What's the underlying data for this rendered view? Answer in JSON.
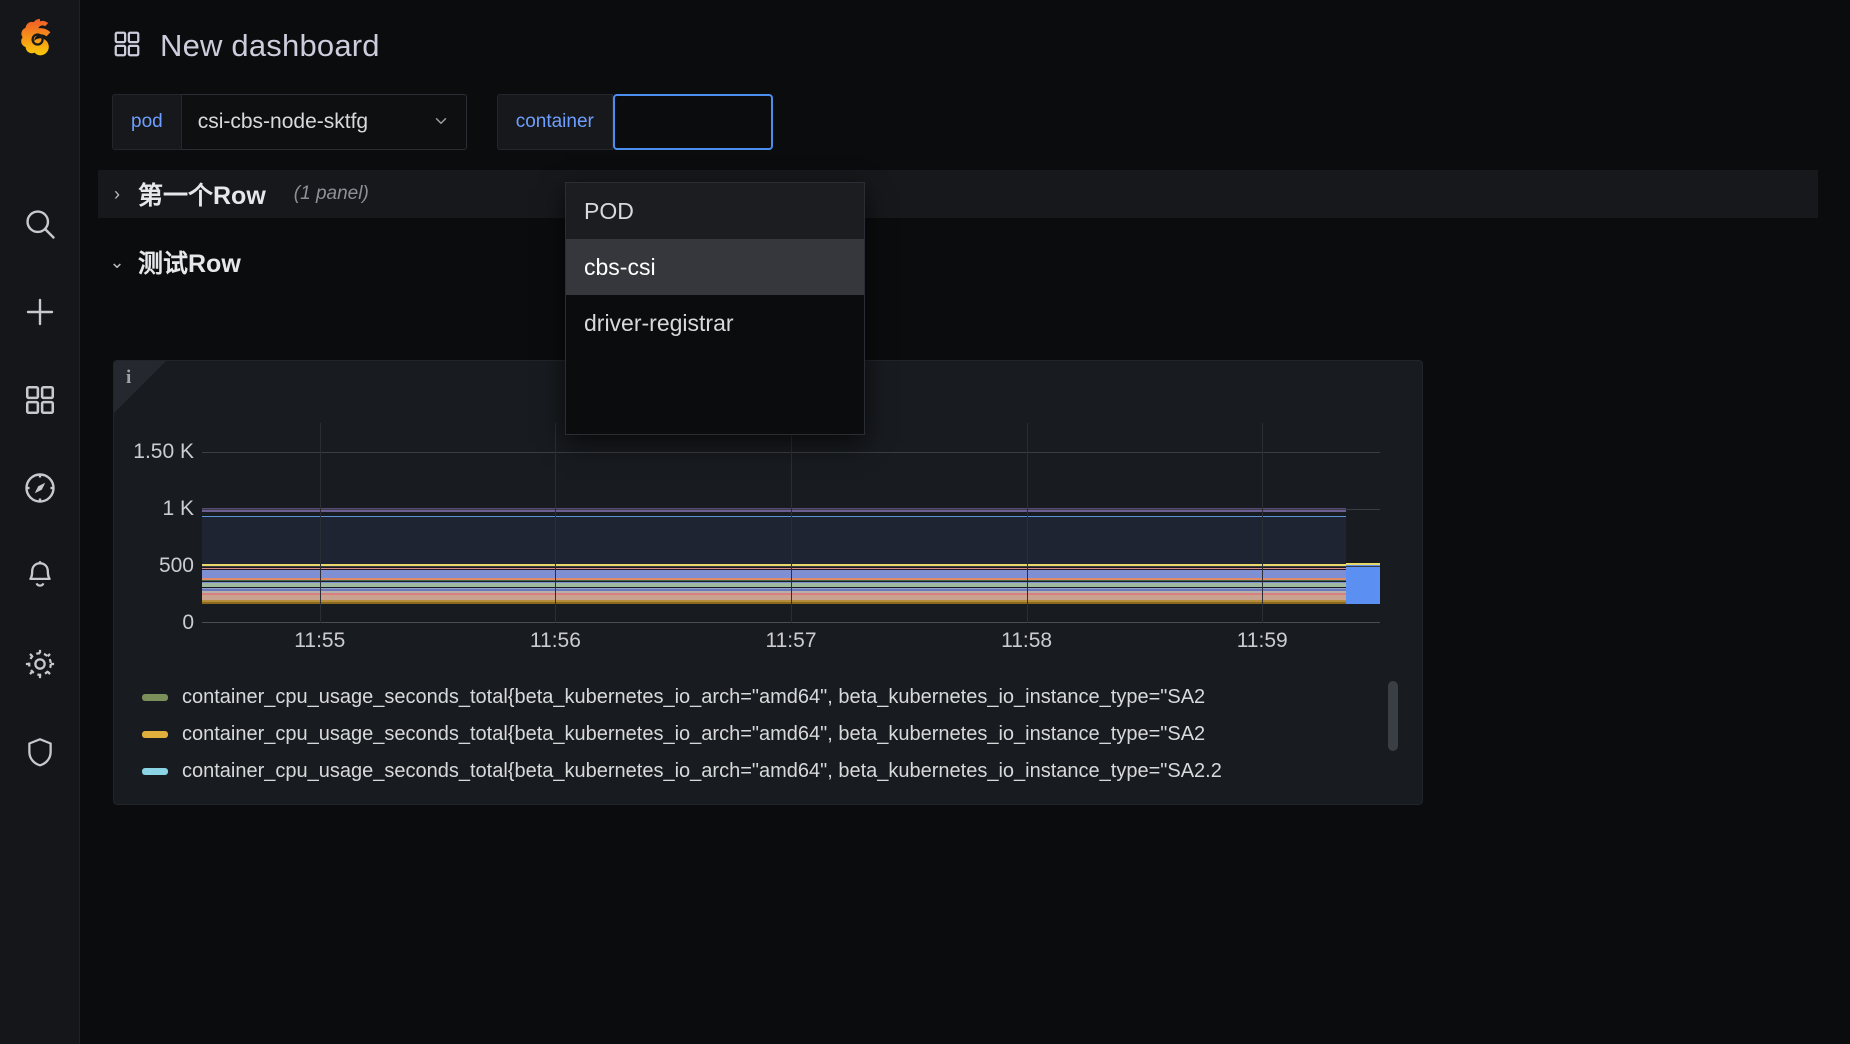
{
  "brand": {
    "logo_icon": "grafana-logo-icon"
  },
  "sidebar": {
    "items": [
      {
        "name": "search-icon",
        "label": "Search"
      },
      {
        "name": "plus-icon",
        "label": "Create"
      },
      {
        "name": "dashboards-icon",
        "label": "Dashboards"
      },
      {
        "name": "compass-icon",
        "label": "Explore"
      },
      {
        "name": "bell-icon",
        "label": "Alerting"
      },
      {
        "name": "gear-icon",
        "label": "Configuration"
      },
      {
        "name": "shield-icon",
        "label": "Server Admin"
      }
    ]
  },
  "header": {
    "title": "New dashboard",
    "icon": "dashboard-grid-icon"
  },
  "variables": [
    {
      "label": "pod",
      "value": "csi-cbs-node-sktfg",
      "caret": "⌄"
    },
    {
      "label": "container",
      "value": "",
      "placeholder": ""
    }
  ],
  "dropdown": {
    "options": [
      {
        "label": "POD",
        "state": "shade"
      },
      {
        "label": "cbs-csi",
        "state": "active"
      },
      {
        "label": "driver-registrar",
        "state": "normal"
      }
    ]
  },
  "rows": [
    {
      "title": "第一个Row",
      "count": "(1 panel)",
      "collapsed": true,
      "chevron": "›"
    },
    {
      "title": "测试Row",
      "count": "",
      "collapsed": false,
      "chevron": "⌄"
    }
  ],
  "panel": {
    "info_icon": "info-icon",
    "info_glyph": "i"
  },
  "chart_data": {
    "type": "area",
    "title": "",
    "xlabel": "",
    "ylabel": "",
    "ylim": [
      0,
      1750
    ],
    "y_ticks": [
      0,
      500,
      1000,
      1500
    ],
    "y_ticklabels": [
      "0",
      "500",
      "1 K",
      "1.50 K"
    ],
    "x": [
      "11:55",
      "11:56",
      "11:57",
      "11:58",
      "11:59"
    ],
    "xlim_labels": [
      "11:55",
      "11:59"
    ],
    "grid": true,
    "legend_position": "bottom",
    "series": [
      {
        "name": "container_cpu_usage_seconds_total{beta_kubernetes_io_arch=\"amd64\", beta_kubernetes_io_instance_type=\"SA2",
        "color": "#7b8f5a",
        "level": 470,
        "kind": "line"
      },
      {
        "name": "container_cpu_usage_seconds_total{beta_kubernetes_io_arch=\"amd64\", beta_kubernetes_io_instance_type=\"SA2",
        "color": "#e0b03c",
        "level": 520,
        "kind": "line"
      },
      {
        "name": "container_cpu_usage_seconds_total{beta_kubernetes_io_arch=\"amd64\", beta_kubernetes_io_instance_type=\"SA2.2",
        "color": "#8ad4e6",
        "level": 880,
        "kind": "line"
      }
    ],
    "bands": [
      {
        "color": "#5a4a78",
        "top": 1010,
        "bottom": 995
      },
      {
        "color": "#6d5f96",
        "top": 985,
        "bottom": 975
      },
      {
        "color": "#1f2433",
        "top": 940,
        "bottom": 520,
        "fill": true
      },
      {
        "color": "#5b93d6",
        "top": 935,
        "bottom": 925
      },
      {
        "color": "#e8d86a",
        "top": 520,
        "bottom": 500
      },
      {
        "color": "#c9a6d8",
        "top": 498,
        "bottom": 486
      },
      {
        "color": "#d98b8b",
        "top": 484,
        "bottom": 470
      },
      {
        "color": "#7f8fd4",
        "top": 468,
        "bottom": 392
      },
      {
        "color": "#e28b6a",
        "top": 390,
        "bottom": 380
      },
      {
        "color": "#4c6b4a",
        "top": 378,
        "bottom": 364
      },
      {
        "color": "#7f8fd4",
        "top": 362,
        "bottom": 352
      },
      {
        "color": "#9fb8a0",
        "top": 350,
        "bottom": 312
      },
      {
        "color": "#8aa0c8",
        "top": 310,
        "bottom": 296
      },
      {
        "color": "#6f77bb",
        "top": 294,
        "bottom": 278
      },
      {
        "color": "#b5b0a8",
        "top": 276,
        "bottom": 262
      },
      {
        "color": "#d97f7f",
        "top": 260,
        "bottom": 244
      },
      {
        "color": "#c9a38f",
        "top": 242,
        "bottom": 200
      },
      {
        "color": "#b58b3c",
        "top": 198,
        "bottom": 184
      },
      {
        "color": "#8a6a1f",
        "top": 182,
        "bottom": 168
      }
    ],
    "end_bar": {
      "color": "#5b8ff2",
      "label": "11:59",
      "top": 505,
      "bottom": 170
    },
    "end_bar_cap": {
      "color": "#e8d86a",
      "top": 525,
      "bottom": 505
    }
  },
  "legend": {
    "entries": [
      {
        "color": "#7b8f5a",
        "text": "container_cpu_usage_seconds_total{beta_kubernetes_io_arch=\"amd64\", beta_kubernetes_io_instance_type=\"SA2"
      },
      {
        "color": "#e0b03c",
        "text": "container_cpu_usage_seconds_total{beta_kubernetes_io_arch=\"amd64\", beta_kubernetes_io_instance_type=\"SA2"
      },
      {
        "color": "#8ad4e6",
        "text": "container_cpu_usage_seconds_total{beta_kubernetes_io_arch=\"amd64\", beta_kubernetes_io_instance_type=\"SA2.2"
      }
    ]
  },
  "colors": {
    "accent_blue": "#6e9fff",
    "focus_blue": "#4b8ef0",
    "panel_bg": "#181b1f",
    "page_bg": "#0b0c0e",
    "rail_bg": "#141619"
  }
}
